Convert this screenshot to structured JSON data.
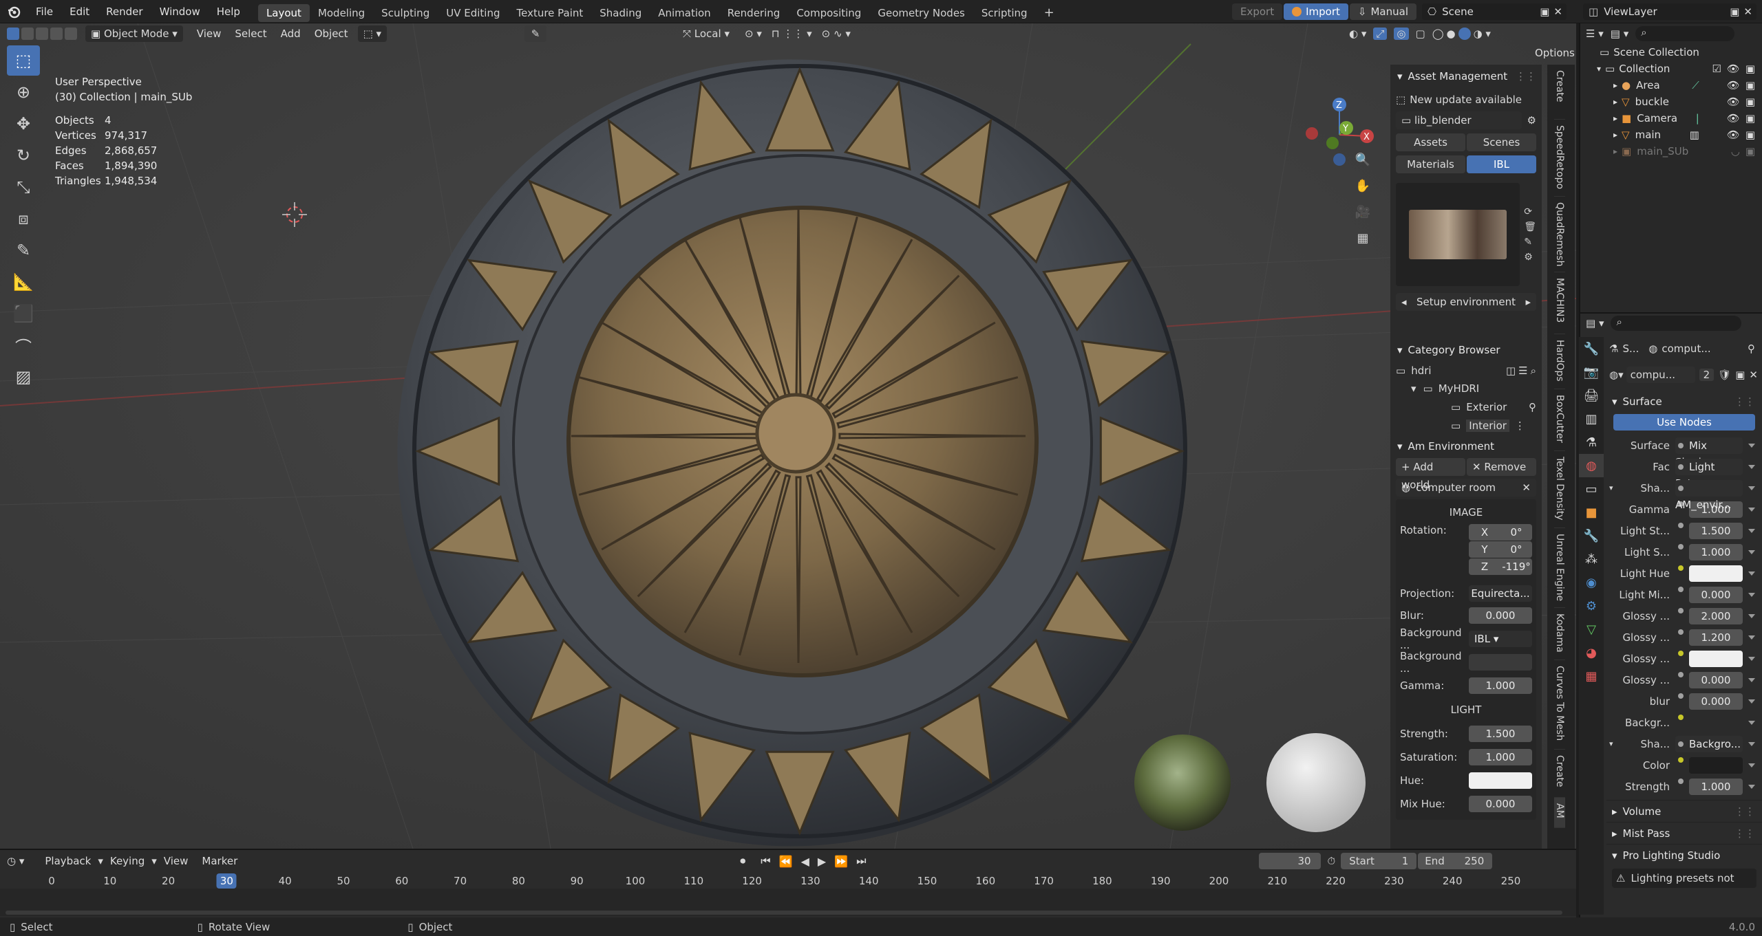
{
  "topbar": {
    "menus": [
      "File",
      "Edit",
      "Render",
      "Window",
      "Help"
    ],
    "workspaces": [
      "Layout",
      "Modeling",
      "Sculpting",
      "UV Editing",
      "Texture Paint",
      "Shading",
      "Animation",
      "Rendering",
      "Compositing",
      "Geometry Nodes",
      "Scripting"
    ],
    "active_workspace": "Layout",
    "export_label": "Export",
    "import_label": "Import",
    "manual_label": "Manual",
    "scene_name": "Scene",
    "view_layer": "ViewLayer"
  },
  "header": {
    "mode": "Object Mode",
    "menus": [
      "View",
      "Select",
      "Add",
      "Object"
    ],
    "transform_orientation": "Local",
    "options_label": "Options"
  },
  "viewport": {
    "perspective": "User Perspective",
    "collection_line": "(30) Collection | main_SUb",
    "stats": [
      {
        "k": "Objects",
        "v": "4"
      },
      {
        "k": "Vertices",
        "v": "974,317"
      },
      {
        "k": "Edges",
        "v": "2,868,657"
      },
      {
        "k": "Faces",
        "v": "1,894,390"
      },
      {
        "k": "Triangles",
        "v": "1,948,534"
      }
    ],
    "gizmo": {
      "x": "X",
      "y": "Y",
      "z": "Z"
    }
  },
  "npanel": {
    "title": "Asset Management",
    "update_notice": "New update available",
    "library": "lib_blender",
    "tabs": [
      "Assets",
      "Scenes",
      "Materials",
      "IBL"
    ],
    "setup_env": "Setup environment",
    "category_title": "Category Browser",
    "category_root": "hdri",
    "category_folder": "MyHDRI",
    "category_items": [
      "Exterior",
      "Interior"
    ],
    "env_title": "Am Environment",
    "add_world": "Add world",
    "remove": "Remove",
    "world_name": "computer room",
    "image_header": "IMAGE",
    "rotation_label": "Rotation:",
    "rot_x_label": "X",
    "rot_x": "0°",
    "rot_y_label": "Y",
    "rot_y": "0°",
    "rot_z_label": "Z",
    "rot_z": "-119°",
    "projection_label": "Projection:",
    "projection_value": "Equirecta...",
    "blur_label": "Blur:",
    "blur": "0.000",
    "background_label": "Background ...",
    "background_value": "IBL",
    "background2_label": "Background ...",
    "gamma_label": "Gamma:",
    "gamma": "1.000",
    "light_header": "LIGHT",
    "strength_label": "Strength:",
    "strength": "1.500",
    "saturation_label": "Saturation:",
    "saturation": "1.000",
    "hue_label": "Hue:",
    "mix_hue_label": "Mix Hue:",
    "mix_hue": "0.000"
  },
  "vertical_tabs": [
    "Create",
    "SpeedRetopo",
    "QuadRemesh",
    "MACHIN3",
    "HardOps",
    "BoxCutter",
    "Texel Density",
    "Unreal Engine",
    "Kodama",
    "Curves To Mesh",
    "Create",
    "AM"
  ],
  "outliner": {
    "root": "Scene Collection",
    "collection": "Collection",
    "items": [
      "Area",
      "buckle",
      "Camera",
      "main",
      "main_SUb"
    ]
  },
  "properties": {
    "breadcrumb_1": "S...",
    "breadcrumb_2": "comput...",
    "world_name": "compu...",
    "users": "2",
    "surface_label": "Surface",
    "use_nodes": "Use Nodes",
    "rows": [
      {
        "label": "Surface",
        "value": "Mix Shad...",
        "type": "link",
        "dot": "g"
      },
      {
        "label": "Fac",
        "value": "Light Pat...",
        "type": "link",
        "dot": "g"
      },
      {
        "label": "Sha...",
        "value": "AM_envir...",
        "type": "link",
        "dot": "g"
      },
      {
        "label": "Gamma",
        "value": "1.000",
        "type": "num",
        "dot": "g"
      },
      {
        "label": "Light St...",
        "value": "1.500",
        "type": "num",
        "dot": "g"
      },
      {
        "label": "Light S...",
        "value": "1.000",
        "type": "num",
        "dot": "g"
      },
      {
        "label": "Light Hue",
        "value": "",
        "type": "color",
        "dot": "y"
      },
      {
        "label": "Light Mi...",
        "value": "0.000",
        "type": "num",
        "dot": "g"
      },
      {
        "label": "Glossy ...",
        "value": "2.000",
        "type": "num",
        "dot": "g"
      },
      {
        "label": "Glossy ...",
        "value": "1.200",
        "type": "num",
        "dot": "g"
      },
      {
        "label": "Glossy ...",
        "value": "",
        "type": "color",
        "dot": "y"
      },
      {
        "label": "Glossy ...",
        "value": "0.000",
        "type": "num",
        "dot": "g"
      },
      {
        "label": "blur",
        "value": "0.000",
        "type": "num",
        "dot": "g"
      },
      {
        "label": "Backgr...",
        "value": "",
        "type": "empty",
        "dot": "y"
      },
      {
        "label": "Sha...",
        "value": "Backgro...",
        "type": "link",
        "dot": "g"
      },
      {
        "label": "Color",
        "value": "",
        "type": "dark",
        "dot": "y"
      },
      {
        "label": "Strength",
        "value": "1.000",
        "type": "num",
        "dot": "g"
      }
    ],
    "volume": "Volume",
    "mist": "Mist Pass",
    "pro_lighting": "Pro Lighting Studio",
    "warning": "Lighting presets not"
  },
  "timeline": {
    "menus": [
      "Playback",
      "Keying",
      "View",
      "Marker"
    ],
    "current_frame": "30",
    "start_label": "Start",
    "start": "1",
    "end_label": "End",
    "end": "250",
    "ticks": [
      "0",
      "10",
      "20",
      "30",
      "40",
      "50",
      "60",
      "70",
      "80",
      "90",
      "100",
      "110",
      "120",
      "130",
      "140",
      "150",
      "160",
      "170",
      "180",
      "190",
      "200",
      "210",
      "220",
      "230",
      "240",
      "250"
    ],
    "playhead": "30"
  },
  "statusbar": {
    "select": "Select",
    "rotate": "Rotate View",
    "object": "Object",
    "version": "4.0.0"
  }
}
